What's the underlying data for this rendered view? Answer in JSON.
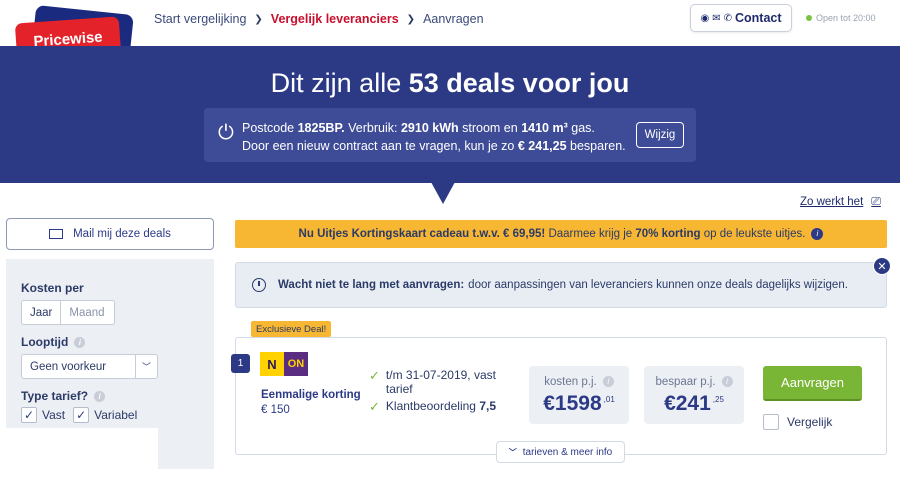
{
  "header": {
    "logo_text": "Pricewise",
    "breadcrumbs": [
      {
        "label": "Start vergelijking",
        "active": false
      },
      {
        "label": "Vergelijk leveranciers",
        "active": true
      },
      {
        "label": "Aanvragen",
        "active": false
      }
    ],
    "contact_label": "Contact",
    "open_status": "Open tot 20:00"
  },
  "hero": {
    "title_pre": "Dit zijn alle",
    "title_bold": "53 deals voor jou",
    "usage": {
      "postcode_label": "Postcode",
      "postcode": "1825BP.",
      "verbruik_label": "Verbruik:",
      "kwh": "2910 kWh",
      "stroom_en": "stroom en",
      "gas_amount": "1410 m³",
      "gas_label": "gas.",
      "line2_pre": "Door een nieuw contract aan te vragen, kun je zo",
      "savings": "€ 241,25",
      "line2_post": "besparen.",
      "edit_button": "Wijzig"
    }
  },
  "how_it_works": "Zo werkt het",
  "sidebar": {
    "mail_button": "Mail mij deze deals",
    "filters": {
      "cost_per_label": "Kosten per",
      "cost_per_options": [
        "Jaar",
        "Maand"
      ],
      "cost_per_selected": "Jaar",
      "duration_label": "Looptijd",
      "duration_value": "Geen voorkeur",
      "tariff_label": "Type tarief?",
      "tariff_options": [
        {
          "label": "Vast",
          "checked": true
        },
        {
          "label": "Variabel",
          "checked": true
        }
      ]
    }
  },
  "promo": {
    "bold_part": "Nu Uitjes Kortingskaart cadeau t.w.v. € 69,95!",
    "mid_part": "Daarmee krijg je",
    "bold_pct": "70% korting",
    "end_part": "op de leukste uitjes."
  },
  "notice": {
    "bold": "Wacht niet te lang met aanvragen:",
    "text": "door aanpassingen van leveranciers kunnen onze deals dagelijks wijzigen."
  },
  "deal": {
    "badge": "Exclusieve Deal!",
    "rank": "1",
    "logo_left": "N",
    "logo_right": "ON",
    "discount_title": "Eenmalige korting",
    "discount_value": "€ 150",
    "feature_1": "t/m 31-07-2019, vast tarief",
    "feature_2_text": "Klantbeoordeling",
    "feature_2_score": "7,5",
    "cost_label": "kosten p.j.",
    "cost_main": "€1598",
    "cost_cents": ",01",
    "save_label": "bespaar p.j.",
    "save_main": "€241",
    "save_cents": ",25",
    "apply_button": "Aanvragen",
    "compare_label": "Vergelijk",
    "more_info": "tarieven & meer info"
  },
  "colors": {
    "brand_navy": "#2c3a86",
    "brand_red": "#e4222a",
    "promo_yellow": "#f7b733",
    "cta_green": "#7ab635"
  }
}
